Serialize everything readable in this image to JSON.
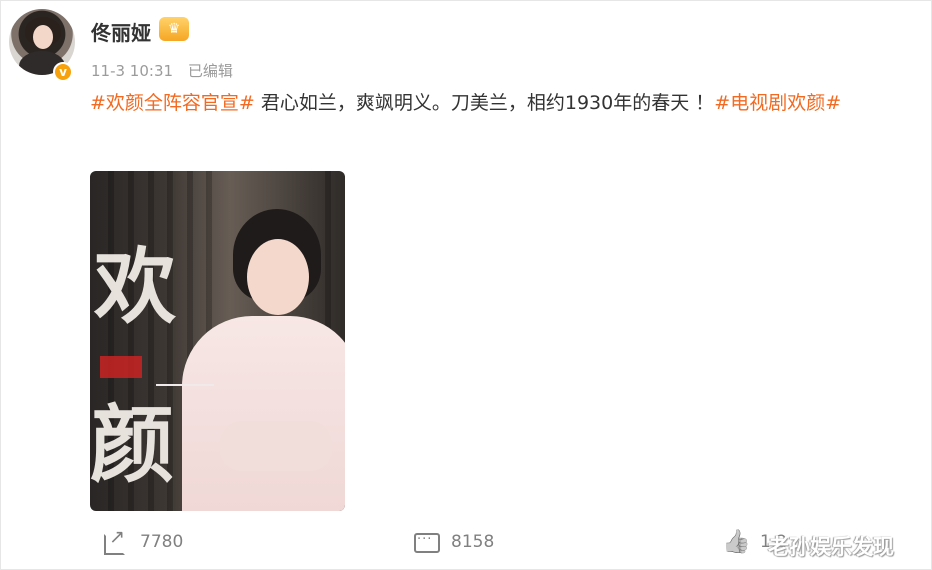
{
  "post": {
    "username": "佟丽娅",
    "timestamp": "11-3 10:31",
    "edited_label": "已编辑",
    "content": {
      "hashtag1": "#欢颜全阵容官宣#",
      "body": " 君心如兰，爽飒明义。刀美兰，相约1930年的春天 ！",
      "hashtag2": "#电视剧欢颜#"
    },
    "poster": {
      "title_top": "欢",
      "title_bottom": "颜"
    }
  },
  "actions": {
    "reposts": "7780",
    "comments": "8158",
    "likes": "1.2"
  },
  "watermark": "老孙娱乐发现",
  "colors": {
    "hashtag": "#f26a21",
    "verify_badge": "#f7a10d"
  },
  "icons": {
    "verify": "verified-badge-icon",
    "member": "member-crown-icon",
    "repost": "repost-icon",
    "comment": "comment-icon",
    "like": "like-icon"
  }
}
